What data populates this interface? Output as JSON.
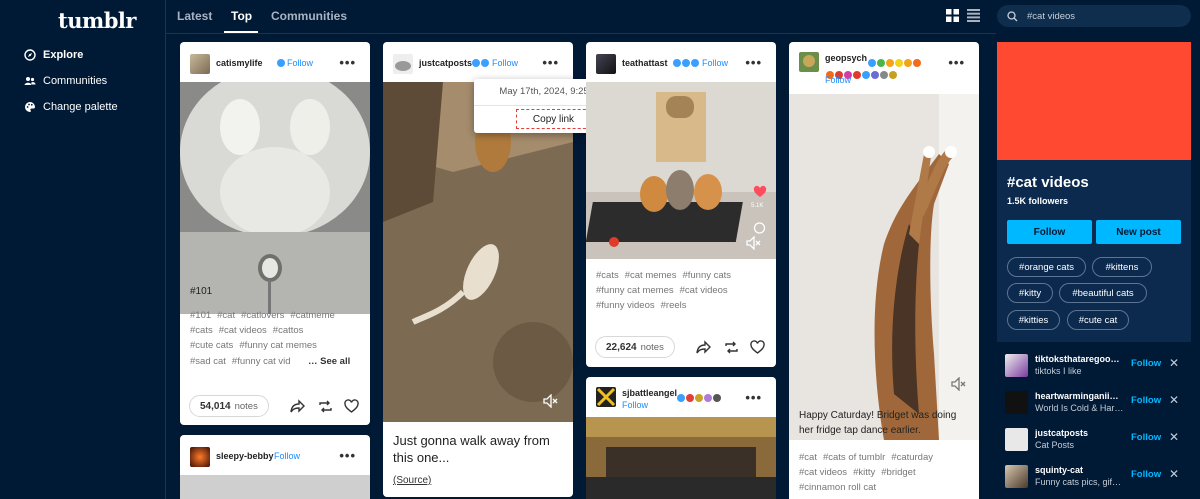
{
  "app": {
    "logo": "tumblr"
  },
  "leftnav": {
    "items": [
      {
        "label": "Explore",
        "icon": "compass-icon"
      },
      {
        "label": "Communities",
        "icon": "people-icon"
      },
      {
        "label": "Change palette",
        "icon": "palette-icon"
      }
    ]
  },
  "tabs": [
    {
      "label": "Latest"
    },
    {
      "label": "Top",
      "active": true
    },
    {
      "label": "Communities"
    }
  ],
  "posts": {
    "p1": {
      "user": "catismylife",
      "follow": "Follow",
      "caption": "#101",
      "tags1": [
        "#101",
        "#cat",
        "#catlovers",
        "#catmeme"
      ],
      "tags2": [
        "#cats",
        "#cat videos",
        "#cattos"
      ],
      "tags3": [
        "#cute cats",
        "#funny cat memes"
      ],
      "tags4": [
        "#sad cat",
        "#funny cat vid"
      ],
      "see_all": "… See all",
      "notes_count": "54,014",
      "notes_label": "notes"
    },
    "p2": {
      "user": "justcatposts",
      "follow": "Follow",
      "caption": "Just gonna walk away from this one...",
      "source": "(Source)"
    },
    "p3": {
      "user": "teathattast",
      "follow": "Follow",
      "tags1": [
        "#cats",
        "#cat memes",
        "#funny cats"
      ],
      "tags2": [
        "#funny cat memes",
        "#cat videos"
      ],
      "tags3": [
        "#funny videos",
        "#reels"
      ],
      "notes_count": "22,624",
      "notes_label": "notes",
      "video_likes": "5.1K"
    },
    "p4": {
      "user": "geopsych",
      "follow": "Follow",
      "caption": "Happy Caturday! Bridget was doing her fridge tap dance earlier.",
      "tags1": [
        "#cat",
        "#cats of tumblr",
        "#caturday"
      ],
      "tags2": [
        "#cat videos",
        "#kitty",
        "#bridget"
      ],
      "tags3": [
        "#cinnamon roll cat"
      ]
    },
    "p5": {
      "user": "sleepy-bebby",
      "follow": "Follow"
    },
    "p6": {
      "user": "sjbattleangel",
      "follow": "Follow"
    }
  },
  "popup": {
    "date": "May 17th, 2024, 9:25 PM",
    "copy_link": "Copy link"
  },
  "search": {
    "value": "#cat videos"
  },
  "tag_card": {
    "title": "#cat videos",
    "followers": "1.5K followers",
    "banner_color": "#ff4930",
    "follow_btn": "Follow",
    "new_post_btn": "New post",
    "chips": [
      "#orange cats",
      "#kittens",
      "#kitty",
      "#beautiful cats",
      "#kitties",
      "#cute cat"
    ]
  },
  "suggestions": [
    {
      "name": "tiktoksthataregoo…",
      "desc": "tiktoks I like",
      "follow": "Follow"
    },
    {
      "name": "heartwarminganii…",
      "desc": "World Is Cold & Har…",
      "follow": "Follow"
    },
    {
      "name": "justcatposts",
      "desc": "Cat Posts",
      "follow": "Follow"
    },
    {
      "name": "squinty-cat",
      "desc": "Funny cats pics, gif…",
      "follow": "Follow"
    }
  ],
  "colors": {
    "bg": "#001935",
    "accent": "#00b8ff",
    "link": "#1a8cff",
    "banner": "#ff4930"
  }
}
